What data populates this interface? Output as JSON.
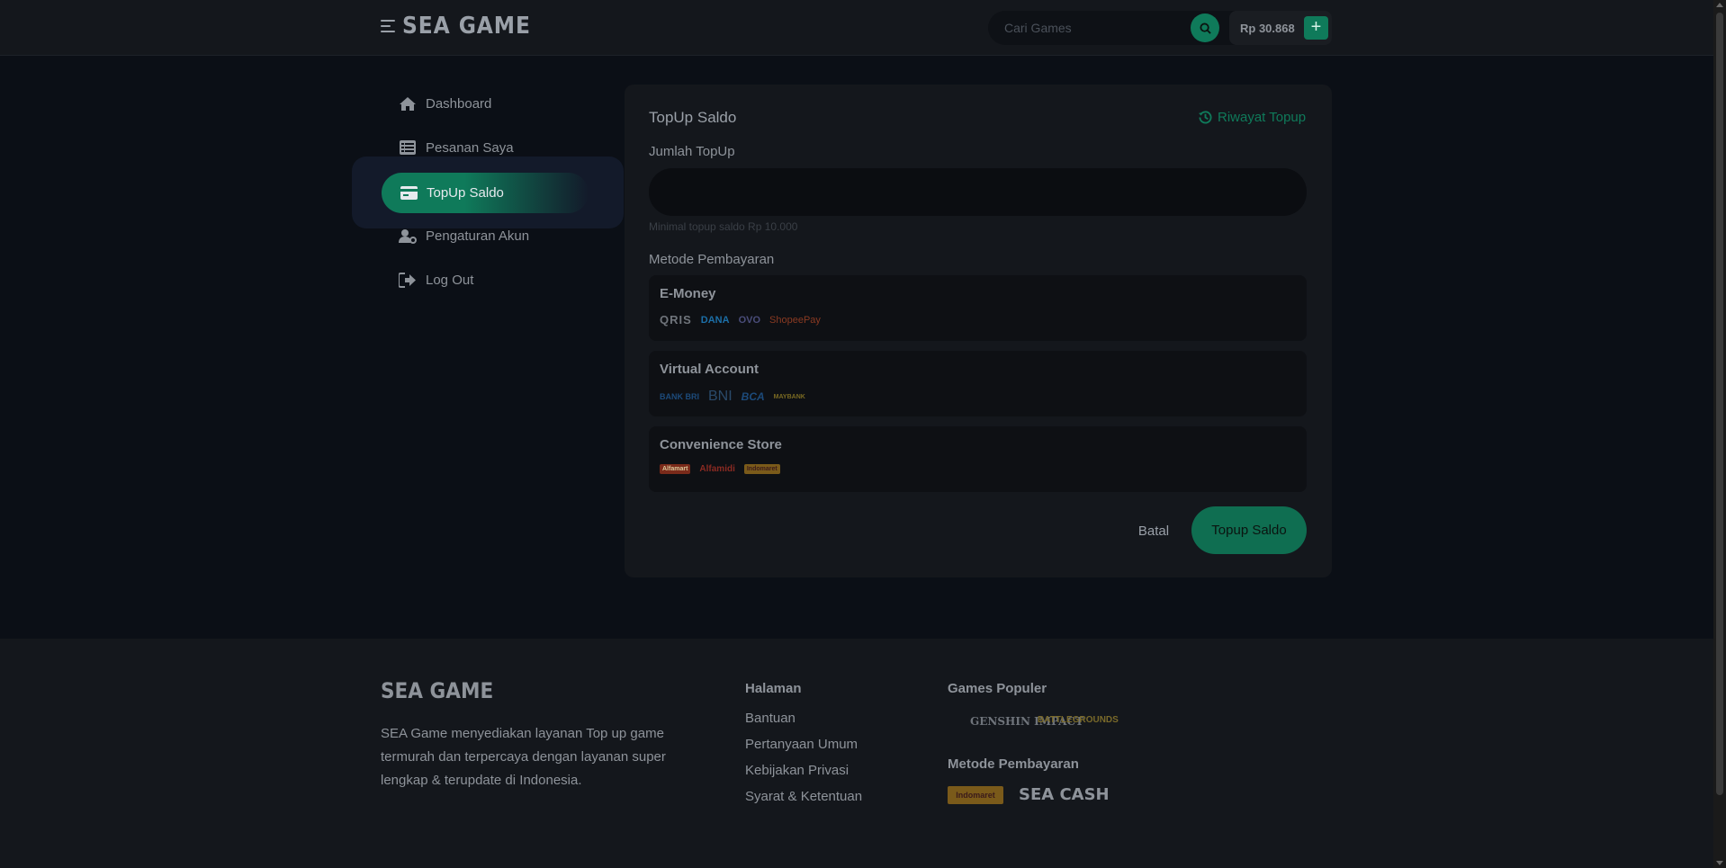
{
  "header": {
    "logo_text": "SEA GAME",
    "search_placeholder": "Cari Games",
    "balance": "Rp 30.868",
    "plus_label": "+"
  },
  "sidebar": {
    "items": [
      {
        "label": "Dashboard",
        "icon": "home-icon"
      },
      {
        "label": "Pesanan Saya",
        "icon": "list-icon"
      },
      {
        "label": "TopUp Saldo",
        "icon": "credit-card-icon",
        "active": true
      },
      {
        "label": "Pengaturan Akun",
        "icon": "user-gear-icon"
      },
      {
        "label": "Log Out",
        "icon": "logout-icon"
      }
    ]
  },
  "topup": {
    "title": "TopUp Saldo",
    "history_label": "Riwayat Topup",
    "amount_label": "Jumlah TopUp",
    "amount_value": "",
    "hint": "Minimal topup saldo Rp 10.000",
    "payment_label": "Metode Pembayaran",
    "methods": [
      {
        "title": "E-Money",
        "logos": [
          "QRIS",
          "DANA",
          "OVO",
          "ShopeePay"
        ]
      },
      {
        "title": "Virtual Account",
        "logos": [
          "BANK BRI",
          "BNI",
          "BCA",
          "MAYBANK"
        ]
      },
      {
        "title": "Convenience Store",
        "logos": [
          "Alfamart",
          "Alfamidi",
          "Indomaret"
        ]
      }
    ],
    "cancel_label": "Batal",
    "submit_label": "Topup Saldo"
  },
  "footer": {
    "logo_text": "SEA GAME",
    "description": "SEA Game menyediakan layanan Top up game termurah dan terpercaya dengan layanan super lengkap & terupdate di Indonesia.",
    "pages_heading": "Halaman",
    "pages": [
      "Bantuan",
      "Pertanyaan Umum",
      "Kebijakan Privasi",
      "Syarat & Ketentuan"
    ],
    "games_heading": "Games Populer",
    "games": [
      "GENSHIN IMPACT",
      "BATTLEGROUNDS"
    ],
    "payment_heading": "Metode Pembayaran",
    "payments": [
      "Indomaret",
      "SEA CASH"
    ]
  },
  "colors": {
    "accent": "#0f7a5a",
    "background": "#0b0f16",
    "panel": "#14171c"
  }
}
